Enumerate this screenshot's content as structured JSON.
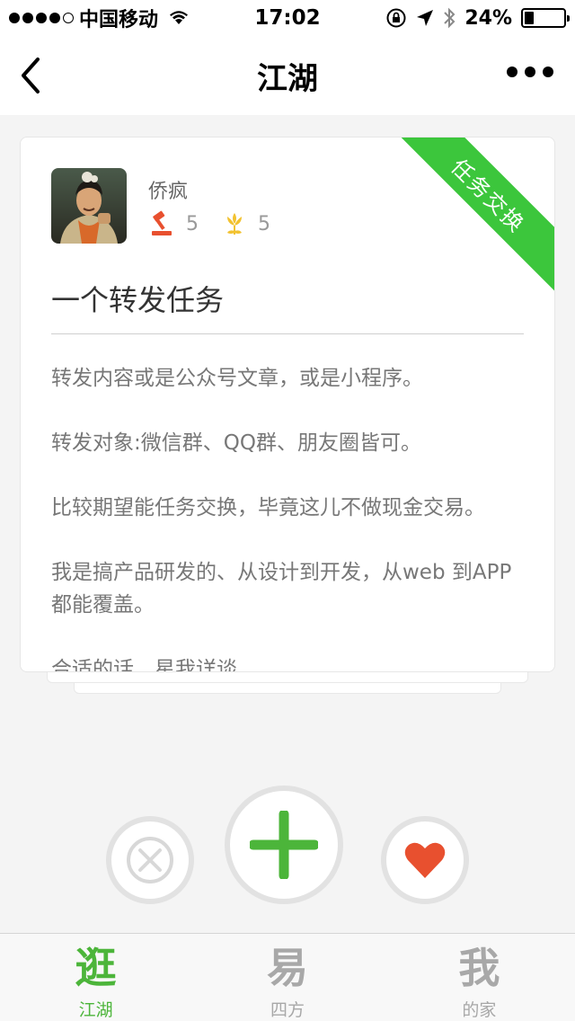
{
  "status_bar": {
    "carrier": "中国移动",
    "time": "17:02",
    "battery_percent_label": "24%",
    "battery_level": 0.24
  },
  "nav": {
    "title": "江湖"
  },
  "card": {
    "ribbon": "任务交换",
    "username": "侨疯",
    "stat_hammer": "5",
    "stat_flower": "5",
    "title": "一个转发任务",
    "paragraphs": [
      "转发内容或是公众号文章，或是小程序。",
      "转发对象:微信群、QQ群、朋友圈皆可。",
      "比较期望能任务交换，毕竟这儿不做现金交易。",
      "我是搞产品研发的、从设计到开发，从web 到APP都能覆盖。",
      "合适的话，星我详谈"
    ]
  },
  "tabs": [
    {
      "icon": "逛",
      "label": "江湖"
    },
    {
      "icon": "易",
      "label": "四方"
    },
    {
      "icon": "我",
      "label": "的家"
    }
  ],
  "colors": {
    "accent_green": "#4cb53a",
    "ribbon_green": "#3cc63c",
    "heart_red": "#e8502f"
  }
}
